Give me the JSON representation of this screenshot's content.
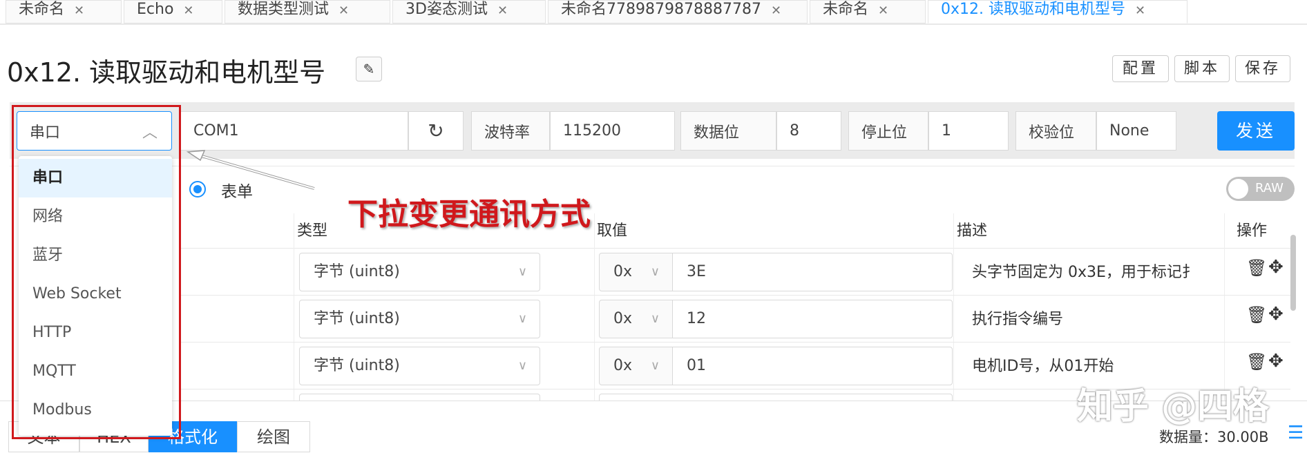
{
  "tabs": [
    {
      "label": "未命名",
      "active": false
    },
    {
      "label": "Echo",
      "active": false
    },
    {
      "label": "数据类型测试",
      "active": false
    },
    {
      "label": "3D姿态测试",
      "active": false
    },
    {
      "label": "未命名7789879878887787",
      "active": false
    },
    {
      "label": "未命名",
      "active": false
    },
    {
      "label": "0x12. 读取驱动和电机型号",
      "active": true
    }
  ],
  "page": {
    "title": "0x12. 读取驱动和电机型号",
    "actions": {
      "config": "配置",
      "script": "脚本",
      "save": "保存"
    }
  },
  "connection": {
    "type": "串口",
    "port": "COM1",
    "baud_label": "波特率",
    "baud": "115200",
    "databits_label": "数据位",
    "databits": "8",
    "stopbits_label": "停止位",
    "stopbits": "1",
    "parity_label": "校验位",
    "parity": "None",
    "send": "发送"
  },
  "dropdown": {
    "options": [
      "串口",
      "网络",
      "蓝牙",
      "Web Socket",
      "HTTP",
      "MQTT",
      "Modbus"
    ],
    "selected": "串口"
  },
  "mode": {
    "form_label": "表单",
    "raw_label": "RAW",
    "raw_on": false
  },
  "annotation": "下拉变更通讯方式",
  "table": {
    "headers": {
      "type": "类型",
      "value": "取值",
      "desc": "描述",
      "ops": "操作"
    },
    "rows": [
      {
        "type": "字节 (uint8)",
        "base": "0x",
        "value": "3E",
        "desc": "头字节固定为 0x3E，用于标记扌"
      },
      {
        "type": "字节 (uint8)",
        "base": "0x",
        "value": "12",
        "desc": "执行指令编号"
      },
      {
        "type": "字节 (uint8)",
        "base": "0x",
        "value": "01",
        "desc": "电机ID号，从01开始"
      }
    ]
  },
  "bottom_tabs": [
    {
      "label": "文本"
    },
    {
      "label": "HEX"
    },
    {
      "label": "格式化",
      "active": true
    },
    {
      "label": "绘图"
    }
  ],
  "status": {
    "data_size": "数据量：30.00B"
  },
  "watermark": "知乎 @四格",
  "colors": {
    "accent": "#1890ff",
    "annotation": "#d0181c"
  }
}
